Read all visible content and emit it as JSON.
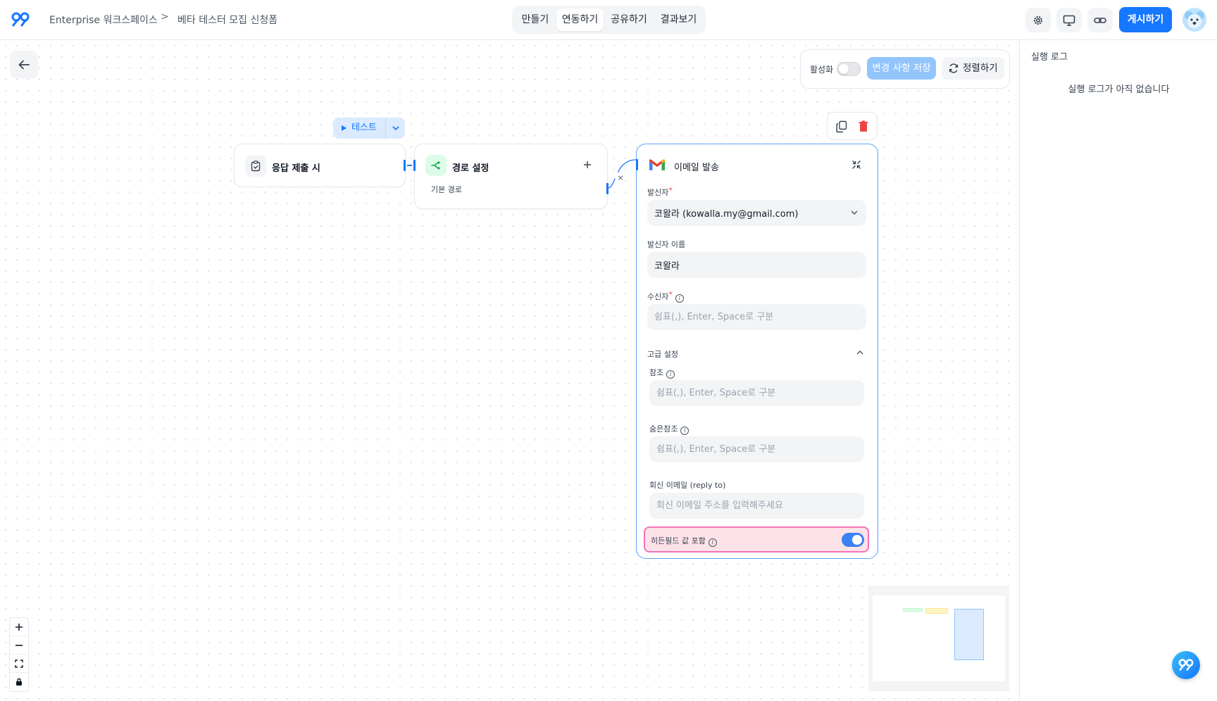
{
  "header": {
    "workspace": "Enterprise 워크스페이스",
    "form_name": "베타 테스터 모집 신청폼",
    "tabs": [
      "만들기",
      "연동하기",
      "공유하기",
      "결과보기"
    ],
    "active_tab": "연동하기",
    "publish_label": "게시하기"
  },
  "toolbar": {
    "active_label": "활성화",
    "save_label": "변경 사항 저장",
    "arrange_label": "정렬하기"
  },
  "flow": {
    "test_label": "테스트",
    "trigger_node": {
      "title": "응답 제출 시"
    },
    "route_node": {
      "title": "경로 설정",
      "path_label": "기본 경로"
    },
    "email_node": {
      "title": "이메일 발송",
      "sender_label": "발신자",
      "sender_value": "코왈라 (kowalla.my@gmail.com)",
      "sender_name_label": "발신자 이름",
      "sender_name_value": "코왈라",
      "recipient_label": "수신자",
      "recipient_placeholder": "쉼표(,), Enter, Space로 구분",
      "advanced_label": "고급 설정",
      "cc_label": "참조",
      "cc_placeholder": "쉼표(,), Enter, Space로 구분",
      "bcc_label": "숨은참조",
      "bcc_placeholder": "쉼표(,), Enter, Space로 구분",
      "reply_to_label": "회신 이메일 (reply to)",
      "reply_to_placeholder": "회신 이메일 주소를 입력해주세요",
      "hidden_field_label": "히든필드 값 포함",
      "hidden_field_enabled": true
    }
  },
  "right_panel": {
    "title": "실행 로그",
    "empty_text": "실행 로그가 아직 없습니다"
  },
  "colors": {
    "accent": "#1677ff",
    "save_disabled": "#93c5fd",
    "highlight_bg": "#fde2e8",
    "highlight_border": "#f472b6"
  }
}
